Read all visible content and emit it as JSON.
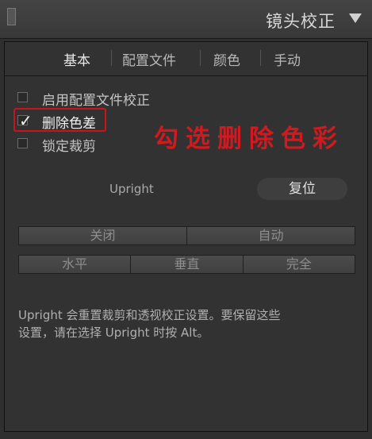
{
  "panel": {
    "title": "镜头校正",
    "tabs": [
      {
        "label": "基本",
        "active": true
      },
      {
        "label": "配置文件",
        "active": false
      },
      {
        "label": "颜色",
        "active": false
      },
      {
        "label": "手动",
        "active": false
      }
    ],
    "options": [
      {
        "label": "启用配置文件校正",
        "checked": false
      },
      {
        "label": "删除色差",
        "checked": true
      },
      {
        "label": "锁定裁剪",
        "checked": false
      }
    ],
    "annotation": "勾选删除色彩",
    "upright": {
      "label": "Upright",
      "reset_label": "复位",
      "row1": [
        "关闭",
        "自动"
      ],
      "row2": [
        "水平",
        "垂直",
        "完全"
      ]
    },
    "help_line1": "Upright 会重置裁剪和透视校正设置。要保留这些",
    "help_line2": "设置，请在选择 Upright 时按 Alt。"
  },
  "colors": {
    "panel_bg": "#323232",
    "highlight_red": "#c8151b"
  }
}
